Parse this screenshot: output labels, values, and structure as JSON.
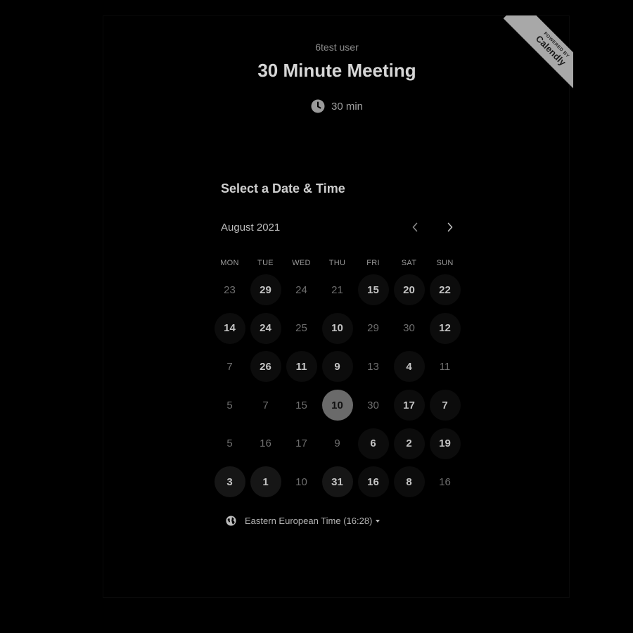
{
  "branding": {
    "powered_by": "POWERED BY",
    "brand": "Calendly"
  },
  "event": {
    "owner": "6test user",
    "title": "30 Minute Meeting",
    "duration": "30 min",
    "duration_icon": "clock-icon"
  },
  "calendar": {
    "heading": "Select a Date & Time",
    "month": "August 2021",
    "prev_icon": "chevron-left-icon",
    "next_icon": "chevron-right-icon",
    "weekdays": [
      "MON",
      "TUE",
      "WED",
      "THU",
      "FRI",
      "SAT",
      "SUN"
    ],
    "weeks": [
      [
        {
          "label": "23",
          "available": false
        },
        {
          "label": "29",
          "available": true
        },
        {
          "label": "24",
          "available": false
        },
        {
          "label": "21",
          "available": false
        },
        {
          "label": "15",
          "available": true
        },
        {
          "label": "20",
          "available": true
        },
        {
          "label": "22",
          "available": true
        }
      ],
      [
        {
          "label": "14",
          "available": true
        },
        {
          "label": "24",
          "available": true
        },
        {
          "label": "25",
          "available": false
        },
        {
          "label": "10",
          "available": true
        },
        {
          "label": "29",
          "available": false
        },
        {
          "label": "30",
          "available": false
        },
        {
          "label": "12",
          "available": true
        }
      ],
      [
        {
          "label": "7",
          "available": false
        },
        {
          "label": "26",
          "available": true
        },
        {
          "label": "11",
          "available": true
        },
        {
          "label": "9",
          "available": true
        },
        {
          "label": "13",
          "available": false
        },
        {
          "label": "4",
          "available": true
        },
        {
          "label": "11",
          "available": false
        }
      ],
      [
        {
          "label": "5",
          "available": false
        },
        {
          "label": "7",
          "available": false
        },
        {
          "label": "15",
          "available": false
        },
        {
          "label": "10",
          "available": true,
          "selected": true
        },
        {
          "label": "30",
          "available": false
        },
        {
          "label": "17",
          "available": true
        },
        {
          "label": "7",
          "available": true
        }
      ],
      [
        {
          "label": "5",
          "available": false
        },
        {
          "label": "16",
          "available": false
        },
        {
          "label": "17",
          "available": false
        },
        {
          "label": "9",
          "available": false
        },
        {
          "label": "6",
          "available": true
        },
        {
          "label": "2",
          "available": true
        },
        {
          "label": "19",
          "available": true
        }
      ],
      [
        {
          "label": "3",
          "available": true,
          "strong": true
        },
        {
          "label": "1",
          "available": true,
          "strong": true
        },
        {
          "label": "10",
          "available": false
        },
        {
          "label": "31",
          "available": true,
          "strong": true
        },
        {
          "label": "16",
          "available": true
        },
        {
          "label": "8",
          "available": true
        },
        {
          "label": "16",
          "available": false
        }
      ]
    ]
  },
  "timezone": {
    "label": "Eastern European Time (16:28)",
    "icon": "globe-icon"
  },
  "colors": {
    "background": "#000000",
    "ribbon": "#a8a8a8",
    "selected_day": "#6a6a6a"
  }
}
